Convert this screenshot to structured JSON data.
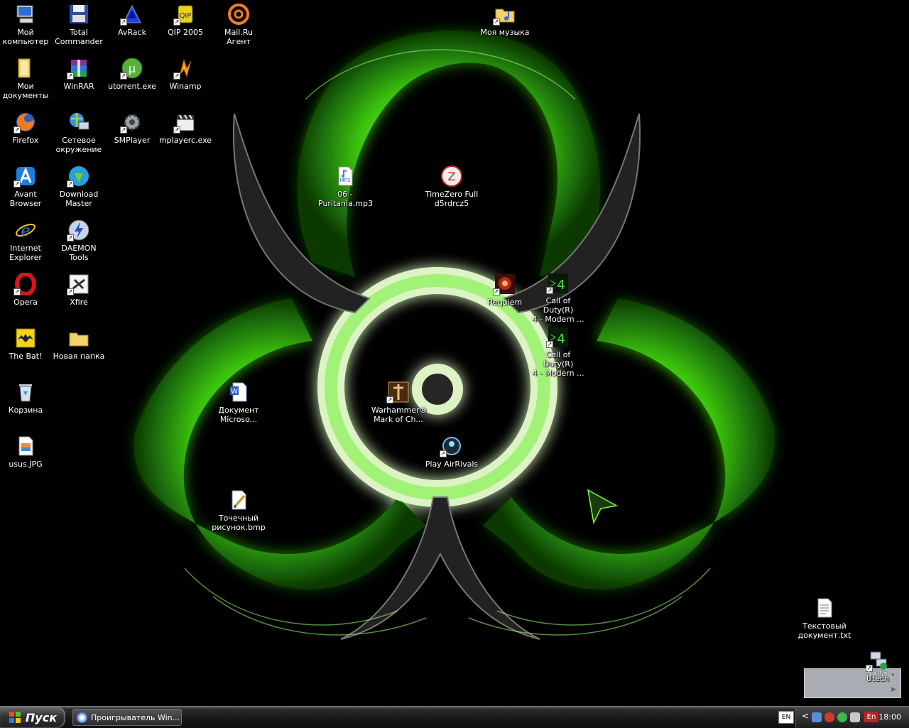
{
  "desktop": {
    "icons": [
      {
        "label": "Мой\nкомпьютер",
        "icon": "my-computer-icon",
        "shortcut": false
      },
      {
        "label": "Total\nCommander",
        "icon": "floppy-disk-icon",
        "shortcut": false
      },
      {
        "label": "AvRack",
        "icon": "avrack-icon",
        "shortcut": true
      },
      {
        "label": "QIP 2005",
        "icon": "qip-icon",
        "shortcut": true
      },
      {
        "label": "Mail.Ru Агент",
        "icon": "mail-agent-icon",
        "shortcut": false
      },
      {
        "label": "Моя музыка",
        "icon": "music-folder-icon",
        "shortcut": true
      },
      {
        "label": "Мои\nдокументы",
        "icon": "documents-folder-icon",
        "shortcut": false
      },
      {
        "label": "WinRAR",
        "icon": "winrar-icon",
        "shortcut": true
      },
      {
        "label": "utorrent.exe",
        "icon": "utorrent-icon",
        "shortcut": true
      },
      {
        "label": "Winamp",
        "icon": "winamp-icon",
        "shortcut": true
      },
      {
        "label": "Firefox",
        "icon": "firefox-icon",
        "shortcut": true
      },
      {
        "label": "Сетевое\nокружение",
        "icon": "network-icon",
        "shortcut": false
      },
      {
        "label": "SMPlayer",
        "icon": "smplayer-icon",
        "shortcut": true
      },
      {
        "label": "mplayerc.exe",
        "icon": "clapperboard-icon",
        "shortcut": true
      },
      {
        "label": "06 -\nPuritania.mp3",
        "icon": "mp3-file-icon",
        "shortcut": false
      },
      {
        "label": "TimeZero Full\nd5rdrcz5",
        "icon": "timezero-icon",
        "shortcut": false
      },
      {
        "label": "Avant Browser",
        "icon": "avant-browser-icon",
        "shortcut": true
      },
      {
        "label": "Download\nMaster",
        "icon": "download-master-icon",
        "shortcut": true
      },
      {
        "label": "Internet\nExplorer",
        "icon": "internet-explorer-icon",
        "shortcut": false
      },
      {
        "label": "DAEMON Tools",
        "icon": "daemon-tools-icon",
        "shortcut": true
      },
      {
        "label": "Opera",
        "icon": "opera-icon",
        "shortcut": true
      },
      {
        "label": "Xfire",
        "icon": "xfire-icon",
        "shortcut": true
      },
      {
        "label": "Requiem",
        "icon": "requiem-icon",
        "shortcut": true
      },
      {
        "label": "Call of Duty(R)\n4 - Modern ...",
        "icon": "cod4-icon",
        "shortcut": true
      },
      {
        "label": "The Bat!",
        "icon": "the-bat-icon",
        "shortcut": false
      },
      {
        "label": "Новая папка",
        "icon": "folder-icon",
        "shortcut": false
      },
      {
        "label": "Call of Duty(R)\n4 - Modern ...",
        "icon": "cod4-icon",
        "shortcut": true
      },
      {
        "label": "Корзина",
        "icon": "recycle-bin-icon",
        "shortcut": false
      },
      {
        "label": "Документ\nMicroso...",
        "icon": "word-document-icon",
        "shortcut": false
      },
      {
        "label": "Warhammer®\nMark of Ch...",
        "icon": "warhammer-icon",
        "shortcut": true
      },
      {
        "label": "Play AirRivals",
        "icon": "airrivals-icon",
        "shortcut": true
      },
      {
        "label": "usus.JPG",
        "icon": "image-file-icon",
        "shortcut": false
      },
      {
        "label": "Точечный\nрисунок.bmp",
        "icon": "bitmap-file-icon",
        "shortcut": false
      },
      {
        "label": "Текстовый\nдокумент.txt",
        "icon": "text-file-icon",
        "shortcut": false
      },
      {
        "label": "Utech",
        "icon": "utech-network-icon",
        "shortcut": true
      }
    ]
  },
  "widget": {
    "speed": "5 KB/s"
  },
  "taskbar": {
    "start_label": "Пуск",
    "window_title": "Проигрыватель Win...",
    "language": "EN",
    "tray_language": "En",
    "clock": "18:00"
  },
  "colors": {
    "glow": "#39ff14",
    "taskbar": "#1a1a1a"
  }
}
